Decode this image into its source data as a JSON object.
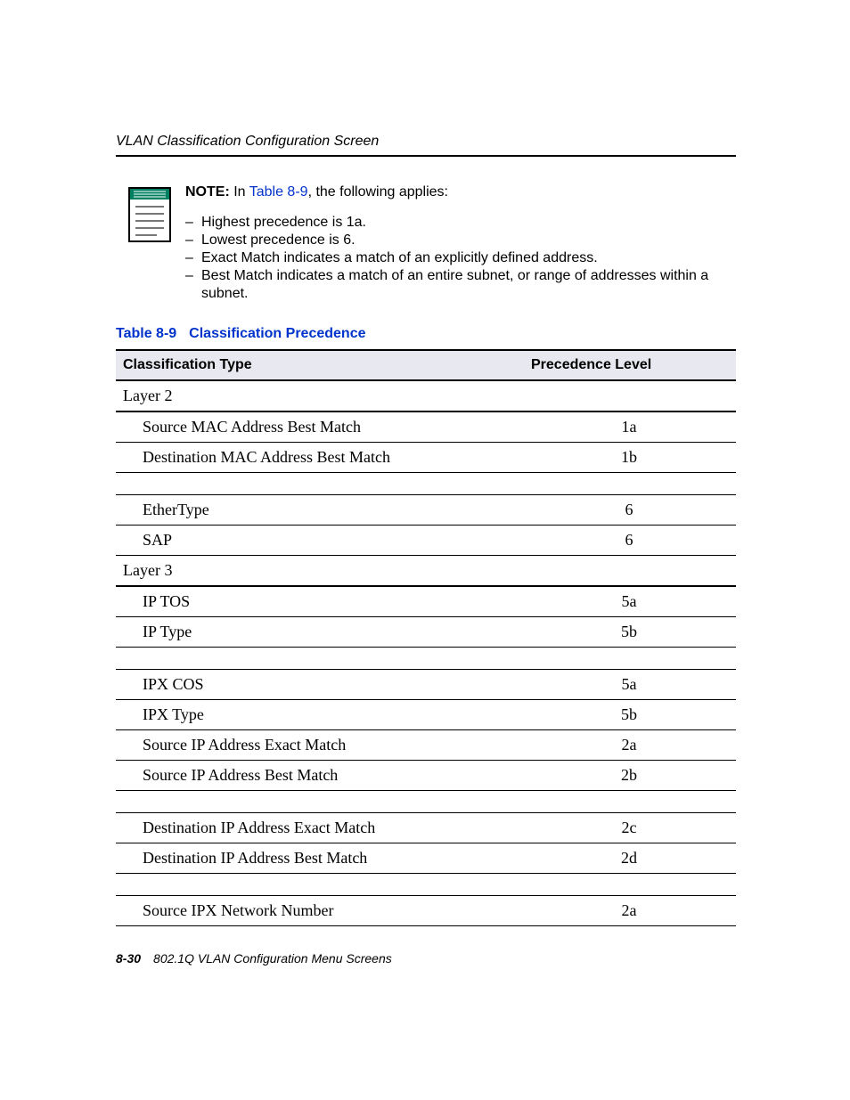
{
  "running_head": "VLAN Classification Configuration Screen",
  "note": {
    "label": "NOTE:",
    "prefix": "In ",
    "link": "Table 8-9",
    "suffix": ", the following applies:",
    "bullets": [
      "Highest precedence is 1a.",
      "Lowest precedence is 6.",
      "Exact Match indicates a match of an explicitly defined address.",
      "Best Match indicates a match of an entire subnet, or range of addresses within a subnet."
    ]
  },
  "table": {
    "caption_num": "Table 8-9",
    "caption_title": "Classification Precedence",
    "headers": {
      "type": "Classification Type",
      "prec": "Precedence Level"
    },
    "rows": [
      {
        "kind": "section",
        "type": "Layer 2"
      },
      {
        "kind": "item",
        "type": "Source MAC Address Best Match",
        "prec": "1a"
      },
      {
        "kind": "item",
        "type": "Destination MAC Address Best Match",
        "prec": "1b"
      },
      {
        "kind": "spacer"
      },
      {
        "kind": "item",
        "type": "EtherType",
        "prec": "6"
      },
      {
        "kind": "item",
        "type": "SAP",
        "prec": "6"
      },
      {
        "kind": "section",
        "type": "Layer 3"
      },
      {
        "kind": "item",
        "type": "IP TOS",
        "prec": "5a"
      },
      {
        "kind": "item",
        "type": "IP Type",
        "prec": "5b"
      },
      {
        "kind": "spacer"
      },
      {
        "kind": "item",
        "type": "IPX COS",
        "prec": "5a"
      },
      {
        "kind": "item",
        "type": "IPX Type",
        "prec": "5b"
      },
      {
        "kind": "item",
        "type": "Source IP Address Exact Match",
        "prec": "2a"
      },
      {
        "kind": "item",
        "type": "Source IP Address Best Match",
        "prec": "2b"
      },
      {
        "kind": "spacer"
      },
      {
        "kind": "item",
        "type": "Destination IP Address Exact Match",
        "prec": "2c"
      },
      {
        "kind": "item",
        "type": "Destination IP Address Best Match",
        "prec": "2d"
      },
      {
        "kind": "spacer"
      },
      {
        "kind": "item",
        "type": "Source IPX Network Number",
        "prec": "2a"
      }
    ]
  },
  "footer": {
    "page_num": "8-30",
    "title": "802.1Q VLAN Configuration Menu Screens"
  }
}
